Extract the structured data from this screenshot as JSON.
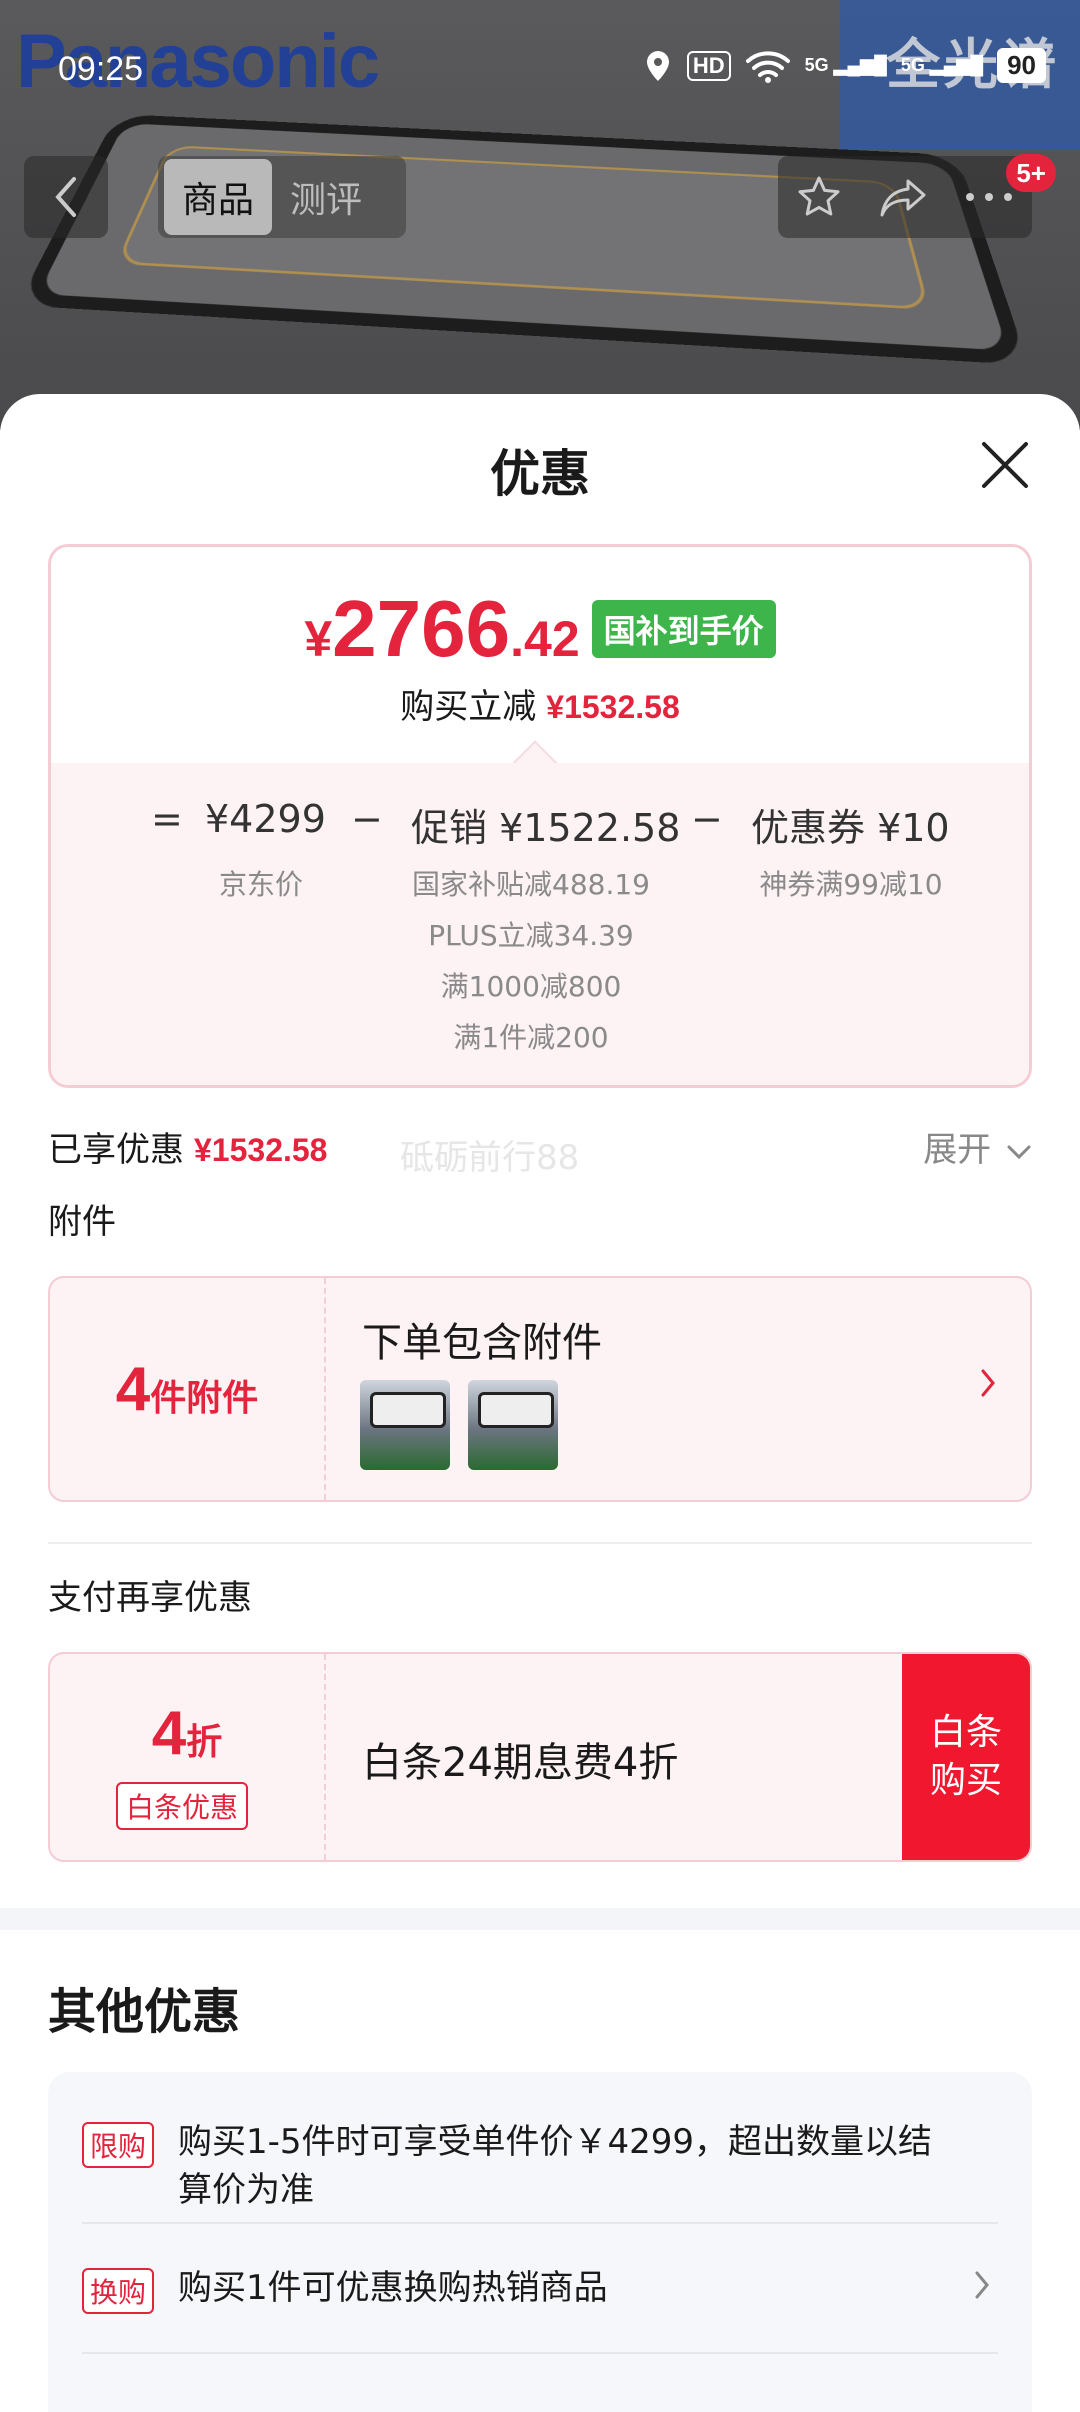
{
  "status_bar": {
    "time": "09:25",
    "hd": "HD",
    "net1": "5G",
    "net2": "5G",
    "battery": "90"
  },
  "background": {
    "brand": "Panasonic",
    "brand_right": "全光谱"
  },
  "navbar": {
    "tabs": [
      "商品",
      "测评"
    ],
    "badge": "5+"
  },
  "sheet": {
    "title": "优惠",
    "price": {
      "yen": "¥",
      "integer": "2766",
      "decimal": ".42",
      "tag": "国补到手价",
      "reduce_label": "购买立减",
      "reduce_amount": "¥1532.58"
    },
    "formula": {
      "eq": "=",
      "jd_price": "¥4299",
      "minus1": "−",
      "promo": "促销 ¥1522.58",
      "minus2": "−",
      "coupon": "优惠券 ¥10",
      "jd_label": "京东价",
      "promo_lines": [
        "国家补贴减488.19",
        "PLUS立减34.39",
        "满1000减800",
        "满1件减200"
      ],
      "coupon_line": "神券满99减10"
    },
    "applied": {
      "label": "已享优惠",
      "amount": "¥1532.58",
      "expand": "展开"
    },
    "watermark": "砥砺前行88",
    "accessories": {
      "section": "附件",
      "count": "4",
      "count_unit": "件附件",
      "title": "下单包含附件"
    },
    "pay": {
      "section": "支付再享优惠",
      "discount": "4",
      "discount_unit": "折",
      "chip": "白条优惠",
      "text": "白条24期息费4折",
      "button_line1": "白条",
      "button_line2": "购买"
    },
    "other": {
      "title": "其他优惠",
      "items": [
        {
          "tag": "限购",
          "text": "购买1-5件时可享受单件价￥4299，超出数量以结算价为准"
        },
        {
          "tag": "换购",
          "text": "购买1件可优惠换购热销商品"
        }
      ]
    }
  },
  "colors": {
    "accent_red": "#e4233c",
    "green_tag": "#3db54a",
    "pink_bg": "#fdf2f4"
  }
}
